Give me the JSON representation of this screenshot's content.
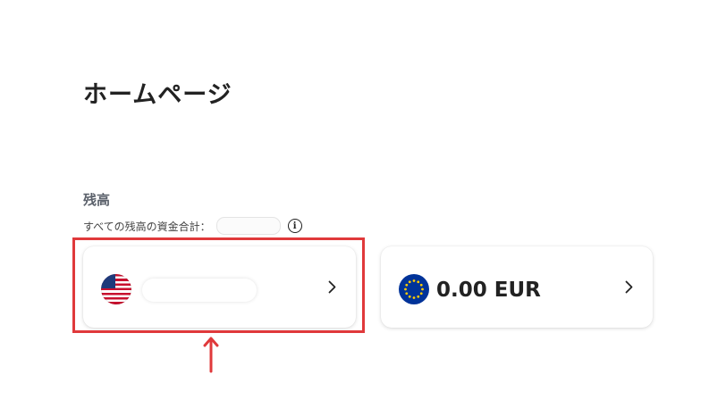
{
  "page": {
    "title": "ホームページ"
  },
  "balance": {
    "section_label": "残高",
    "total_label": "すべての残高の資金合計：",
    "info_icon": "info-icon"
  },
  "accounts": [
    {
      "currency_flag": "us-flag-icon",
      "amount": "",
      "chevron": "chevron-right-icon"
    },
    {
      "currency_flag": "eu-flag-icon",
      "amount": "0.00 EUR",
      "chevron": "chevron-right-icon"
    }
  ],
  "annotation": {
    "highlight_color": "#e0393b"
  },
  "colors": {
    "eu_blue": "#003399",
    "eu_star": "#ffcc00",
    "us_red": "#c8102e",
    "us_blue": "#1f3a7a"
  }
}
